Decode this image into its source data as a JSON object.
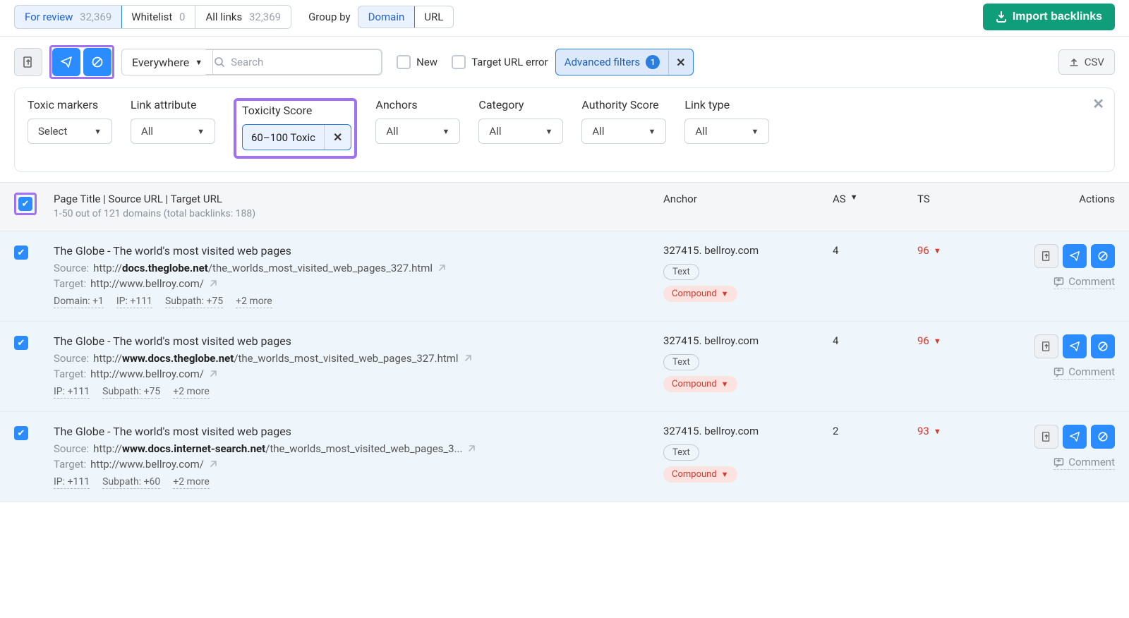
{
  "tabs": {
    "for_review": {
      "label": "For review",
      "count": "32,369"
    },
    "whitelist": {
      "label": "Whitelist",
      "count": "0"
    },
    "all_links": {
      "label": "All links",
      "count": "32,369"
    }
  },
  "group_by": {
    "label": "Group by",
    "domain": "Domain",
    "url": "URL"
  },
  "import_button": "Import backlinks",
  "search": {
    "dropdown": "Everywhere",
    "placeholder": "Search"
  },
  "checkboxes": {
    "new": "New",
    "target_url_error": "Target URL error"
  },
  "advanced_filters": {
    "label": "Advanced filters",
    "count": "1"
  },
  "csv_button": "CSV",
  "filters": {
    "toxic_markers": {
      "label": "Toxic markers",
      "value": "Select"
    },
    "link_attribute": {
      "label": "Link attribute",
      "value": "All"
    },
    "toxicity_score": {
      "label": "Toxicity Score",
      "chip": "60–100 Toxic"
    },
    "anchors": {
      "label": "Anchors",
      "value": "All"
    },
    "category": {
      "label": "Category",
      "value": "All"
    },
    "authority_score": {
      "label": "Authority Score",
      "value": "All"
    },
    "link_type": {
      "label": "Link type",
      "value": "All"
    }
  },
  "table": {
    "header": {
      "title": "Page Title | Source URL | Target URL",
      "sub": "1-50 out of 121 domains (total backlinks: 188)",
      "anchor": "Anchor",
      "as": "AS",
      "ts": "TS",
      "actions": "Actions"
    },
    "row_common": {
      "source_label": "Source:",
      "target_label": "Target:",
      "text_badge": "Text",
      "compound_badge": "Compound",
      "comment": "Comment"
    },
    "rows": [
      {
        "title": "The Globe - The world's most visited web pages",
        "source_prefix": "http://",
        "source_bold": "docs.theglobe.net",
        "source_rest": "/the_worlds_most_visited_web_pages_327.html",
        "target": "http://www.bellroy.com/",
        "meta": [
          "Domain: +1",
          "IP: +111",
          "Subpath: +75",
          "+2 more"
        ],
        "anchor": "327415. bellroy.com",
        "as": "4",
        "ts": "96"
      },
      {
        "title": "The Globe - The world's most visited web pages",
        "source_prefix": "http://",
        "source_bold": "www.docs.theglobe.net",
        "source_rest": "/the_worlds_most_visited_web_pages_327.html",
        "target": "http://www.bellroy.com/",
        "meta": [
          "IP: +111",
          "Subpath: +75",
          "+2 more"
        ],
        "anchor": "327415. bellroy.com",
        "as": "4",
        "ts": "96"
      },
      {
        "title": "The Globe - The world's most visited web pages",
        "source_prefix": "http://",
        "source_bold": "www.docs.internet-search.net",
        "source_rest": "/the_worlds_most_visited_web_pages_3...",
        "target": "http://www.bellroy.com/",
        "meta": [
          "IP: +111",
          "Subpath: +60",
          "+2 more"
        ],
        "anchor": "327415. bellroy.com",
        "as": "2",
        "ts": "93"
      }
    ]
  }
}
